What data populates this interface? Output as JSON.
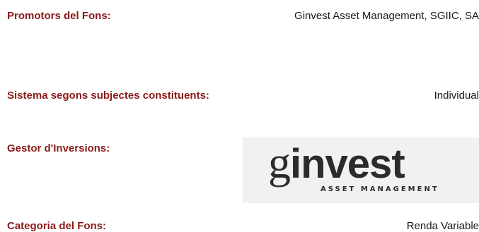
{
  "fund": {
    "promotors": {
      "label": "Promotors del Fons:",
      "value": "Ginvest Asset Management, SGIIC, SA"
    },
    "sistema": {
      "label": "Sistema segons subjectes constituents:",
      "value": "Individual"
    },
    "gestor": {
      "label": "Gestor d'Inversions:",
      "logo": {
        "word_g": "g",
        "word_rest": "invest",
        "subtitle": "ASSET MANAGEMENT"
      }
    },
    "categoria": {
      "label": "Categoria del Fons:",
      "value": "Renda Variable"
    }
  },
  "colors": {
    "label": "#8b1a1a",
    "value": "#1a1a1a",
    "logo_bg": "#f1f1f1"
  }
}
